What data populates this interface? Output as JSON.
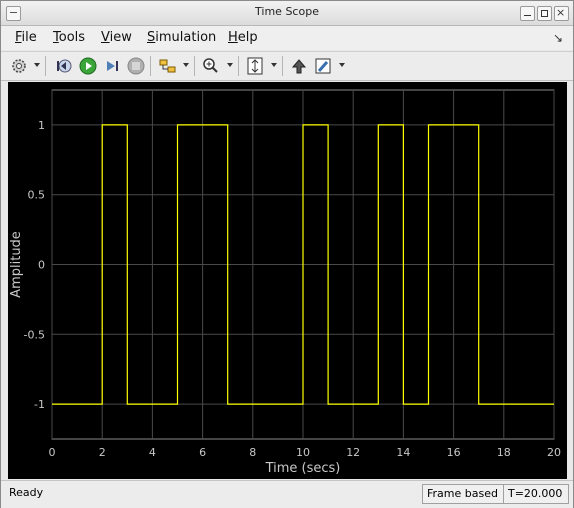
{
  "window": {
    "title": "Time Scope"
  },
  "menu": {
    "items": [
      {
        "label": "File",
        "mnemonic": "F",
        "rest": "ile"
      },
      {
        "label": "Tools",
        "mnemonic": "T",
        "rest": "ools"
      },
      {
        "label": "View",
        "mnemonic": "V",
        "rest": "iew"
      },
      {
        "label": "Simulation",
        "mnemonic": "S",
        "rest": "imulation"
      },
      {
        "label": "Help",
        "mnemonic": "H",
        "rest": "elp"
      }
    ]
  },
  "toolbar": {
    "icons": [
      "gear-icon",
      "step-back-icon",
      "run-icon",
      "step-forward-icon",
      "stop-icon",
      "signal-select-icon",
      "zoom-in-icon",
      "scale-axes-icon",
      "highlight-block-icon",
      "style-icon"
    ]
  },
  "plot": {
    "ylabel": "Amplitude",
    "xlabel": "Time (secs)",
    "xticks": [
      "0",
      "2",
      "4",
      "6",
      "8",
      "10",
      "12",
      "14",
      "16",
      "18",
      "20"
    ],
    "yticks": [
      "1",
      "0.5",
      "0",
      "-0.5",
      "-1"
    ],
    "line_color": "#ffff00",
    "grid_color": "#4a4a4a",
    "background": "#000000"
  },
  "chart_data": {
    "type": "line",
    "xlabel": "Time (secs)",
    "ylabel": "Amplitude",
    "xlim": [
      0,
      20
    ],
    "ylim": [
      -1.25,
      1.25
    ],
    "grid": true,
    "series": [
      {
        "step": true,
        "x": [
          0,
          2,
          3,
          5,
          7,
          10,
          11,
          13,
          14,
          15,
          17,
          20
        ],
        "y": [
          -1,
          1,
          -1,
          1,
          -1,
          1,
          -1,
          1,
          -1,
          1,
          -1,
          -1
        ]
      }
    ]
  },
  "status": {
    "text": "Ready",
    "frame": "Frame based",
    "time": "T=20.000"
  }
}
